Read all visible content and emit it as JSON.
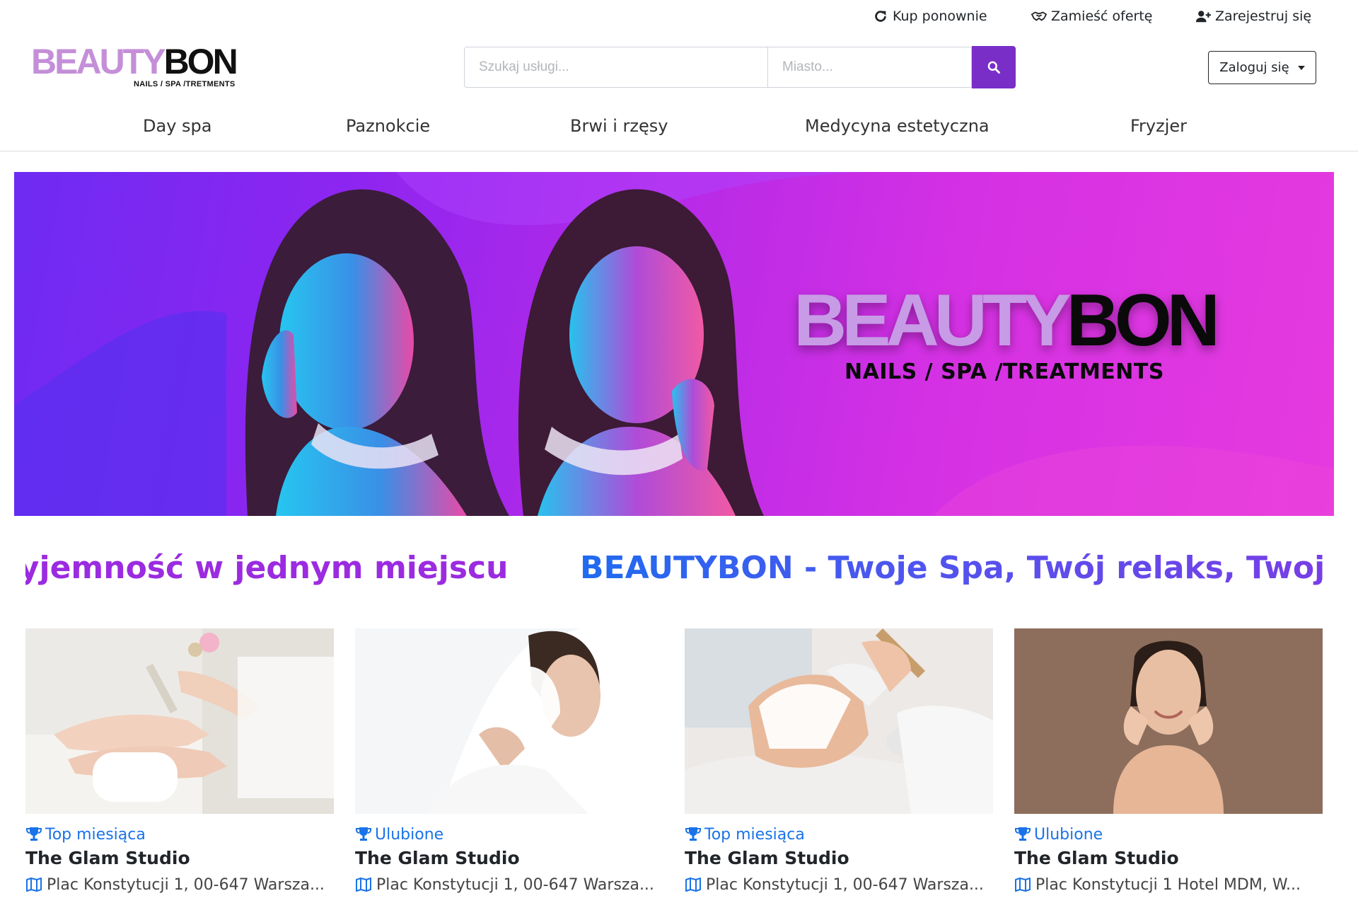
{
  "topbar": {
    "buy_again": "Kup ponownie",
    "post_offer": "Zamieść ofertę",
    "register": "Zarejestruj się"
  },
  "logo": {
    "part_a": "BEAUTY",
    "part_b": "BON",
    "tagline": "NAILS / SPA /TRETMENTS"
  },
  "search": {
    "service_placeholder": "Szukaj usługi...",
    "city_placeholder": "Miasto..."
  },
  "login": {
    "label": "Zaloguj się"
  },
  "categories": [
    "Day spa",
    "Paznokcie",
    "Brwi i rzęsy",
    "Medycyna estetyczna",
    "Fryzjer"
  ],
  "banner": {
    "brand_a": "BEAUTY",
    "brand_b": "BON",
    "tagline": "NAILS / SPA /TREATMENTS",
    "colors": {
      "start": "#6e2bf2",
      "end": "#e53adf"
    }
  },
  "marquee": {
    "segment_1": "przyjemność w jednym miejscu",
    "segment_2": "BEAUTYBON - Twoje Spa, Twój relaks, Twoja p"
  },
  "cards": [
    {
      "badge": "Top miesiąca",
      "name": "The Glam Studio",
      "address": "Plac Konstytucji 1, 00-647 Warsza...",
      "image": "manicure"
    },
    {
      "badge": "Ulubione",
      "name": "The Glam Studio",
      "address": "Plac Konstytucji 1, 00-647 Warsza...",
      "image": "bride-veil"
    },
    {
      "badge": "Top miesiąca",
      "name": "The Glam Studio",
      "address": "Plac Konstytucji 1, 00-647 Warsza...",
      "image": "facial-mask"
    },
    {
      "badge": "Ulubione",
      "name": "The Glam Studio",
      "address": "Plac Konstytucji 1 Hotel MDM, W...",
      "image": "skincare-portrait"
    }
  ],
  "accent_color": "#7a2ec8",
  "link_color": "#1a73e8"
}
